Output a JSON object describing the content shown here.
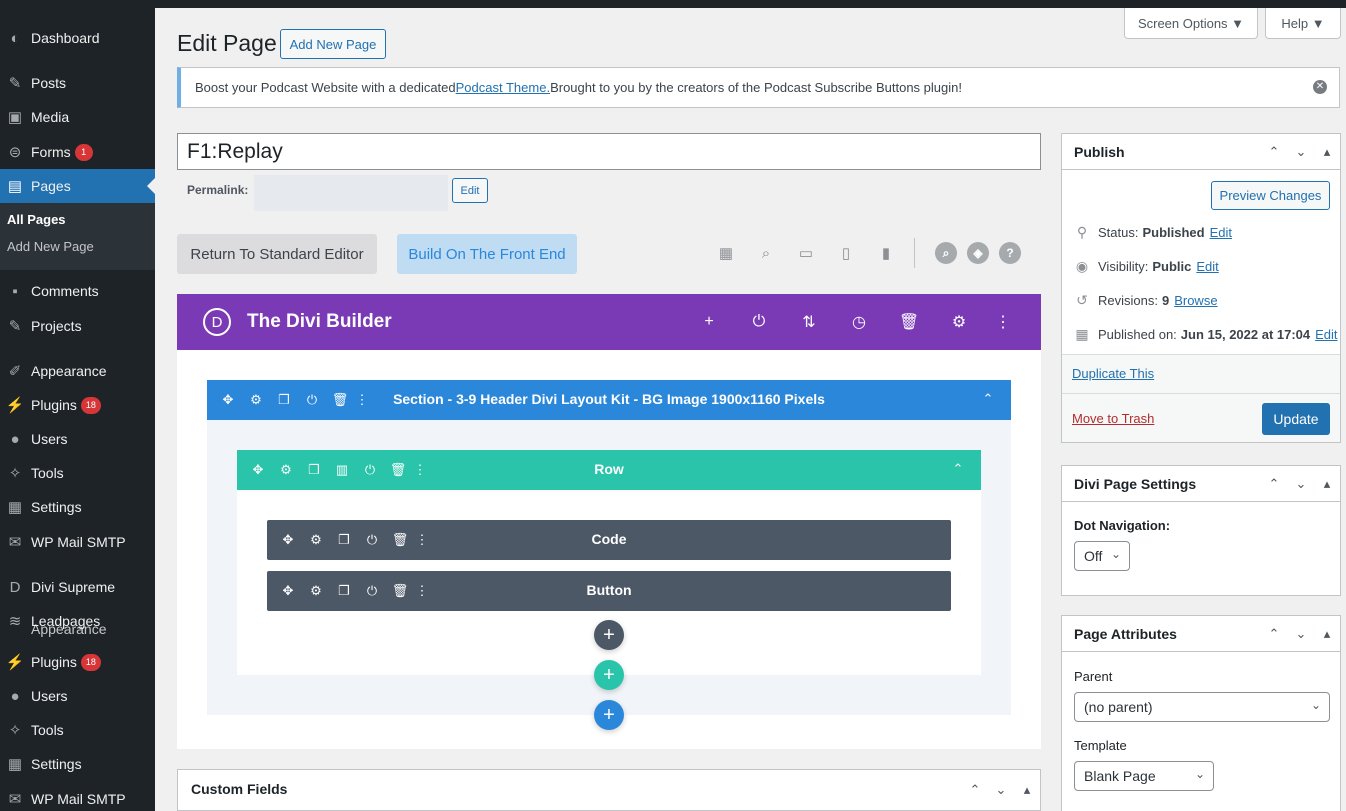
{
  "sidebar": {
    "items": [
      {
        "label": "Dashboard",
        "icon": "dashboard-icon",
        "glyph": "◐"
      },
      {
        "label": "Posts",
        "icon": "pin-icon",
        "glyph": "✎"
      },
      {
        "label": "Media",
        "icon": "media-icon",
        "glyph": "▣"
      },
      {
        "label": "Forms",
        "icon": "forms-icon",
        "glyph": "⊜",
        "badge": "1"
      },
      {
        "label": "Pages",
        "icon": "pages-icon",
        "glyph": "▤"
      },
      {
        "label": "Comments",
        "icon": "comments-icon",
        "glyph": "▪"
      },
      {
        "label": "Projects",
        "icon": "projects-icon",
        "glyph": "✎"
      },
      {
        "label": "Appearance",
        "icon": "brush-icon",
        "glyph": "✐"
      },
      {
        "label": "Plugins",
        "icon": "plug-icon",
        "glyph": "⚡",
        "badge": "18"
      },
      {
        "label": "Users",
        "icon": "user-icon",
        "glyph": "●"
      },
      {
        "label": "Tools",
        "icon": "wrench-icon",
        "glyph": "✧"
      },
      {
        "label": "Settings",
        "icon": "settings-icon",
        "glyph": "▦"
      },
      {
        "label": "WP Mail SMTP",
        "icon": "mail-icon",
        "glyph": "✉"
      },
      {
        "label": "Divi Supreme",
        "icon": "divi-supreme-icon",
        "glyph": "D"
      },
      {
        "label": "Leadpages",
        "icon": "layers-icon",
        "glyph": "≋"
      },
      {
        "label": "Plugins",
        "icon": "plug-icon",
        "glyph": "⚡",
        "badge": "18"
      },
      {
        "label": "Users",
        "icon": "user-icon",
        "glyph": "●"
      },
      {
        "label": "Tools",
        "icon": "wrench-icon",
        "glyph": "✧"
      },
      {
        "label": "Settings",
        "icon": "settings-icon",
        "glyph": "▦"
      },
      {
        "label": "WP Mail SMTP",
        "icon": "mail-icon",
        "glyph": "✉"
      }
    ],
    "submenu": {
      "current": "All Pages",
      "other": "Add New Page"
    },
    "overlap_label": "Appearance"
  },
  "header": {
    "screen_options": "Screen Options ▼",
    "help": "Help ▼",
    "page_title": "Edit Page",
    "add_new": "Add New Page"
  },
  "notice": {
    "text_before": "Boost your Podcast Website with a dedicated ",
    "link": "Podcast Theme.",
    "text_after": " Brought to you by the creators of the Podcast Subscribe Buttons plugin!"
  },
  "editor": {
    "title_value": "F1:Replay",
    "permalink_label": "Permalink:",
    "permalink_edit": "Edit",
    "return_std": "Return To Standard Editor",
    "build_front": "Build On The Front End"
  },
  "divi": {
    "logo": "D",
    "title": "The Divi Builder",
    "section_title": "Section - 3-9 Header Divi Layout Kit - BG Image 1900x1160 Pixels",
    "row_title": "Row",
    "modules": [
      "Code",
      "Button"
    ]
  },
  "custom_fields": {
    "title": "Custom Fields"
  },
  "publish": {
    "title": "Publish",
    "preview": "Preview Changes",
    "status_label": "Status:",
    "status_value": "Published",
    "status_edit": "Edit",
    "visibility_label": "Visibility:",
    "visibility_value": "Public",
    "visibility_edit": "Edit",
    "revisions_label": "Revisions:",
    "revisions_value": "9",
    "revisions_link": "Browse",
    "published_label": "Published on:",
    "published_value": "Jun 15, 2022 at 17:04",
    "published_edit": "Edit",
    "duplicate": "Duplicate This",
    "trash": "Move to Trash",
    "update": "Update"
  },
  "divi_settings": {
    "title": "Divi Page Settings",
    "dot_nav_label": "Dot Navigation:",
    "dot_nav_value": "Off"
  },
  "page_attributes": {
    "title": "Page Attributes",
    "parent_label": "Parent",
    "parent_value": "(no parent)",
    "template_label": "Template",
    "template_value": "Blank Page"
  },
  "colors": {
    "wp_blue": "#2271b1",
    "divi_purple": "#7b3ab5",
    "section_blue": "#2b87da",
    "row_teal": "#29c4a9",
    "module_gray": "#4c5866",
    "badge_red": "#d63638"
  }
}
